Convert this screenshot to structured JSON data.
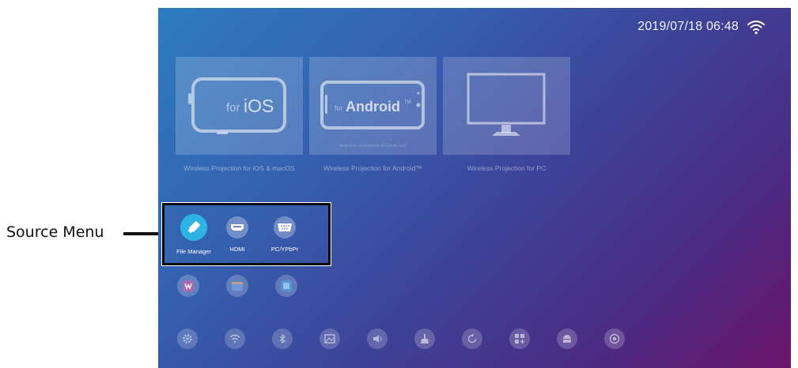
{
  "callout": {
    "label": "Source Menu"
  },
  "status": {
    "datetime": "2019/07/18 06:48",
    "wifi_icon": "wifi-icon"
  },
  "cards": [
    {
      "id": "ios",
      "name": "for",
      "brand": "iOS",
      "caption": "Wireless Projection for iOS & macOS",
      "icon": "phone-icon"
    },
    {
      "id": "android",
      "name": "for",
      "brand": "Android",
      "trademark": "TM",
      "fine_print": "Android is a trademark of Google LLC",
      "caption": "Wireless Projection for Android™",
      "icon": "phone-icon"
    },
    {
      "id": "pc",
      "caption": "Wireless Projection for PC",
      "icon": "monitor-icon"
    }
  ],
  "source_menu": {
    "items": [
      {
        "label": "File Manager",
        "icon": "usb-drive-icon",
        "active": true
      },
      {
        "label": "HDMI",
        "icon": "hdmi-icon",
        "active": false
      },
      {
        "label": "PC/YPbPr",
        "icon": "vga-icon",
        "active": false
      }
    ]
  },
  "apps": [
    {
      "icon": "wps-office-icon"
    },
    {
      "icon": "video-player-icon"
    },
    {
      "icon": "gallery-app-icon"
    }
  ],
  "settings_icons": [
    "gear-icon",
    "wifi-icon",
    "bluetooth-icon",
    "picture-icon",
    "speaker-icon",
    "cleaner-icon",
    "update-icon",
    "app-grid-icon",
    "android-icon",
    "target-icon"
  ],
  "colors": {
    "accent": "#2eb3e6",
    "gradient_start": "#2e7cc0",
    "gradient_end": "#6a1468"
  }
}
